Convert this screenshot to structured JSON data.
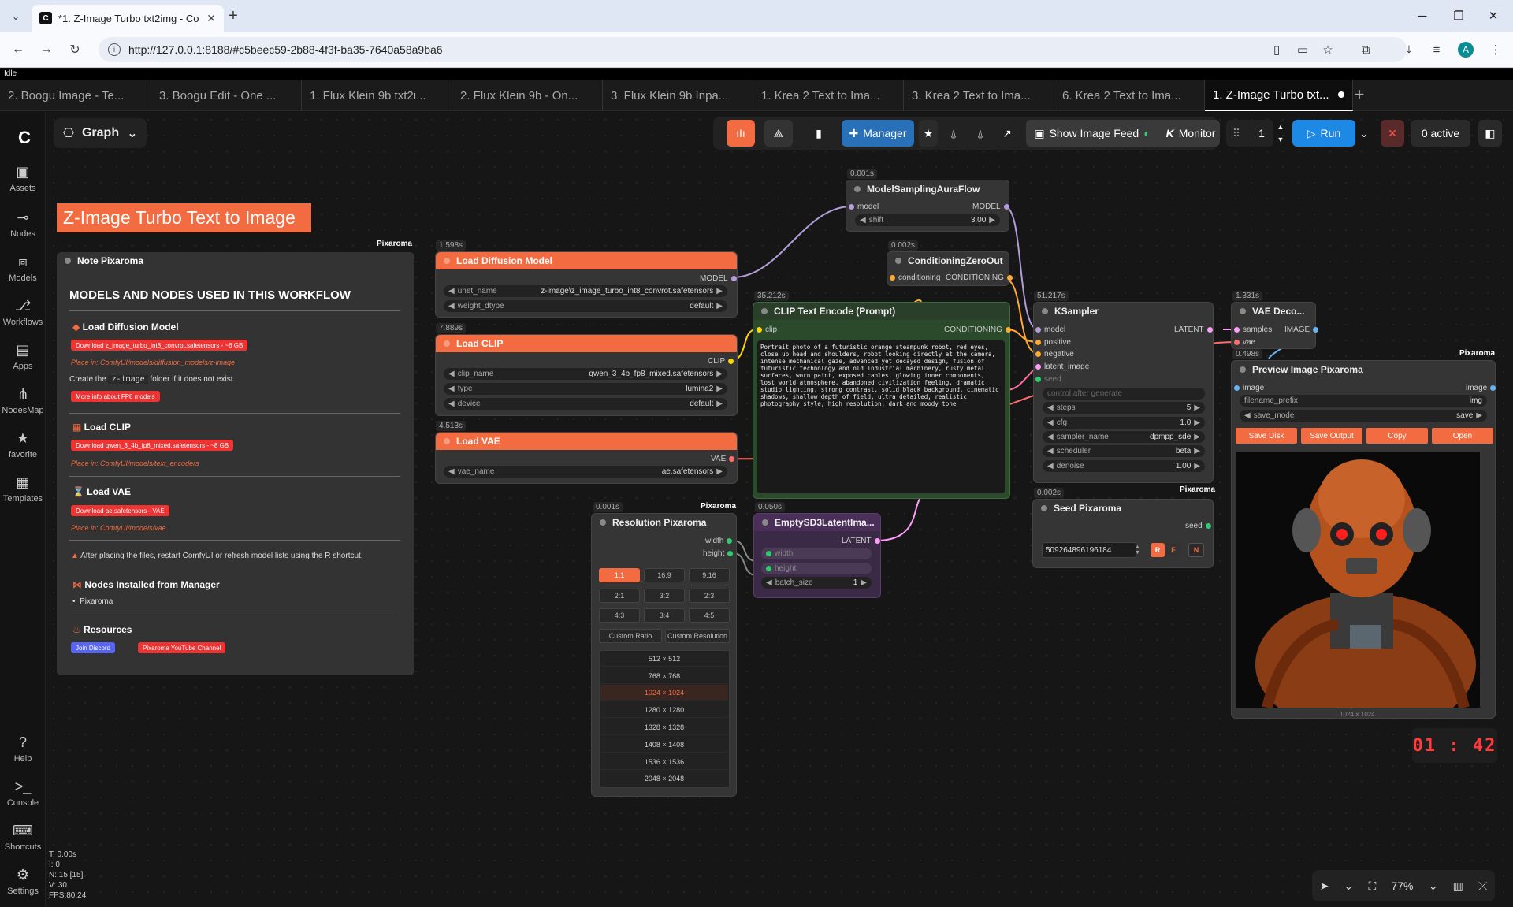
{
  "browser": {
    "tab_title": "*1. Z-Image Turbo txt2img - Co",
    "url": "http://127.0.0.1:8188/#c5beec59-2b88-4f3f-ba35-7640a58a9ba6",
    "avatar": "A"
  },
  "status": "Idle",
  "workflow_tabs": [
    "2. Boogu Image - Te...",
    "3. Boogu Edit - One ...",
    "1. Flux Klein 9b txt2i...",
    "2. Flux Klein 9b - On...",
    "3. Flux Klein 9b Inpa...",
    "1. Krea 2 Text to Ima...",
    "3. Krea 2 Text to Ima...",
    "6. Krea 2 Text to Ima...",
    "1. Z-Image Turbo txt..."
  ],
  "sidebar": [
    "Assets",
    "Nodes",
    "Models",
    "Workflows",
    "Apps",
    "NodesMap",
    "favorite",
    "Templates"
  ],
  "sidebar_bottom": [
    "Help",
    "Console",
    "Shortcuts",
    "Settings"
  ],
  "graph_label": "Graph",
  "toolbar": {
    "manager": "Manager",
    "show_feed": "Show Image Feed",
    "monitor": "Monitor",
    "batch": "1",
    "run": "Run",
    "active": "0 active"
  },
  "title_banner": "Z-Image Turbo Text to Image",
  "note": {
    "header": "Note Pixaroma",
    "tag": "Pixaroma",
    "heading": "MODELS AND NODES USED IN THIS WORKFLOW",
    "s1_title": "Load Diffusion Model",
    "s1_dl": "Download z_image_turbo_int8_convrot.safetensors  -  ~6 GB",
    "s1_place": "Place in: ComfyUI/models/diffusion_models/z-image",
    "s1_create_a": "Create the",
    "s1_create_code": "z-image",
    "s1_create_b": "folder if it does not exist.",
    "s1_more": "More info about FP8 models",
    "s2_title": "Load CLIP",
    "s2_dl": "Download qwen_3_4b_fp8_mixed.safetensors  -  ~8 GB",
    "s2_place": "Place in: ComfyUI/models/text_encoders",
    "s3_title": "Load VAE",
    "s3_dl": "Download ae.safetensors  -  VAE",
    "s3_place": "Place in: ComfyUI/models/vae",
    "warn": "After placing the files, restart ComfyUI or refresh model lists using the R shortcut.",
    "s4_title": "Nodes Installed from Manager",
    "s4_item": "Pixaroma",
    "s5_title": "Resources",
    "discord": "Join Discord",
    "youtube": "Pixaroma YouTube Channel"
  },
  "nodes": {
    "diffusion": {
      "time": "1.598s",
      "title": "Load Diffusion Model",
      "out": "MODEL",
      "unet_label": "unet_name",
      "unet_val": "z-image\\z_image_turbo_int8_convrot.safetensors",
      "dtype_label": "weight_dtype",
      "dtype_val": "default"
    },
    "clip": {
      "time": "7.889s",
      "title": "Load CLIP",
      "out": "CLIP",
      "name_label": "clip_name",
      "name_val": "qwen_3_4b_fp8_mixed.safetensors",
      "type_label": "type",
      "type_val": "lumina2",
      "device_label": "device",
      "device_val": "default"
    },
    "vae": {
      "time": "4.513s",
      "title": "Load VAE",
      "out": "VAE",
      "name_label": "vae_name",
      "name_val": "ae.safetensors"
    },
    "msaf": {
      "time": "0.001s",
      "title": "ModelSamplingAuraFlow",
      "in": "model",
      "out": "MODEL",
      "shift_label": "shift",
      "shift_val": "3.00"
    },
    "czo": {
      "time": "0.002s",
      "title": "ConditioningZeroOut",
      "in": "conditioning",
      "out": "CONDITIONING"
    },
    "clipenc": {
      "time": "35.212s",
      "title": "CLIP Text Encode (Prompt)",
      "in": "clip",
      "out": "CONDITIONING",
      "text": "Portrait photo of a futuristic orange steampunk robot, red eyes, close up head and shoulders, robot looking directly at the camera, intense mechanical gaze, advanced yet decayed design, fusion of futuristic technology and old industrial machinery, rusty metal surfaces, worn paint, exposed cables, glowing inner components, lost world atmosphere, abandoned civilization feeling, dramatic studio lighting, strong contrast, solid black background, cinematic shadows, shallow depth of field, ultra detailed, realistic photography style, high resolution, dark and moody tone"
    },
    "ksampler": {
      "time": "51.217s",
      "title": "KSampler",
      "in1": "model",
      "in2": "positive",
      "in3": "negative",
      "in4": "latent_image",
      "in5": "seed",
      "out": "LATENT",
      "control": "control after generate",
      "steps_l": "steps",
      "steps_v": "5",
      "cfg_l": "cfg",
      "cfg_v": "1.0",
      "sampler_l": "sampler_name",
      "sampler_v": "dpmpp_sde",
      "sched_l": "scheduler",
      "sched_v": "beta",
      "denoise_l": "denoise",
      "denoise_v": "1.00"
    },
    "vaedec": {
      "time": "1.331s",
      "title": "VAE Deco...",
      "in1": "samples",
      "in2": "vae",
      "out": "IMAGE"
    },
    "preview": {
      "time": "0.498s",
      "tag": "Pixaroma",
      "title": "Preview Image Pixaroma",
      "in": "image",
      "out": "image",
      "prefix_l": "filename_prefix",
      "prefix_v": "img",
      "mode_l": "save_mode",
      "mode_v": "save",
      "b1": "Save Disk",
      "b2": "Save Output",
      "b3": "Copy",
      "b4": "Open",
      "size": "1024 × 1024"
    },
    "seed": {
      "time": "0.002s",
      "tag": "Pixaroma",
      "title": "Seed Pixaroma",
      "out": "seed",
      "value": "509264896196184",
      "r": "R",
      "f": "F",
      "n": "N"
    },
    "resolution": {
      "time": "0.001s",
      "tag": "Pixaroma",
      "title": "Resolution Pixaroma",
      "out1": "width",
      "out2": "height",
      "ratios": [
        "1:1",
        "16:9",
        "9:16",
        "2:1",
        "3:2",
        "2:3",
        "4:3",
        "3:4",
        "4:5"
      ],
      "custom1": "Custom Ratio",
      "custom2": "Custom Resolution",
      "sizes": [
        "512 × 512",
        "768 × 768",
        "1024 × 1024",
        "1280 × 1280",
        "1328 × 1328",
        "1408 × 1408",
        "1536 × 1536",
        "2048 × 2048"
      ]
    },
    "latent": {
      "time": "0.050s",
      "title": "EmptySD3LatentIma...",
      "out": "LATENT",
      "w": "width",
      "h": "height",
      "batch_l": "batch_size",
      "batch_v": "1"
    }
  },
  "timer": "01 : 42",
  "stats": [
    "T: 0.00s",
    "I: 0",
    "N: 15 [15]",
    "V: 30",
    "FPS:80.24"
  ],
  "zoom": "77%",
  "colors": {
    "accent": "#f36b41",
    "run": "#1e88e5",
    "manager": "#2870b8"
  }
}
